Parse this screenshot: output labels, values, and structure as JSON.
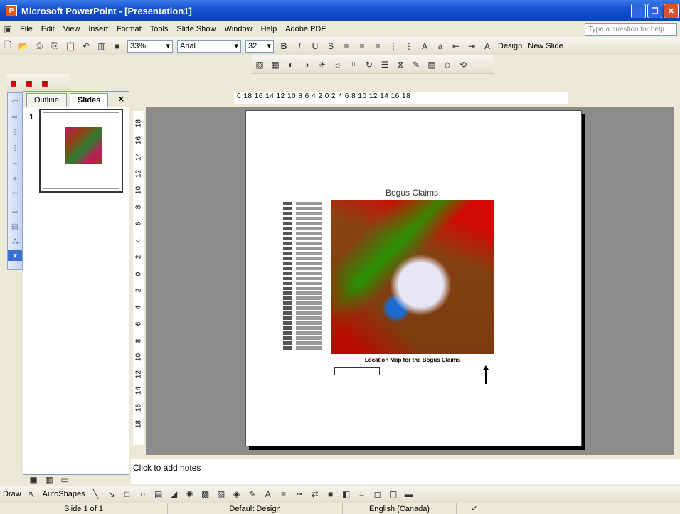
{
  "window": {
    "title": "Microsoft PowerPoint - [Presentation1]",
    "app_icon": "P"
  },
  "menu": {
    "items": [
      "File",
      "Edit",
      "View",
      "Insert",
      "Format",
      "Tools",
      "Slide Show",
      "Window",
      "Help",
      "Adobe PDF"
    ],
    "help_placeholder": "Type a question for help"
  },
  "toolbar": {
    "zoom": "33%",
    "font": "Arial",
    "font_size": "32",
    "design_label": "Design",
    "new_slide_label": "New Slide"
  },
  "panel": {
    "tabs": [
      "Outline",
      "Slides"
    ],
    "active_tab": "Slides",
    "slide_number": "1"
  },
  "ruler": {
    "horizontal": "0  18  16  14  12  10  8  6  4  2  0  2  4  6  8  10  12  14  16  18",
    "vertical": [
      "18",
      "16",
      "14",
      "12",
      "10",
      "8",
      "6",
      "4",
      "2",
      "0",
      "2",
      "4",
      "6",
      "8",
      "10",
      "12",
      "14",
      "16",
      "18"
    ]
  },
  "slide": {
    "title": "Bogus Claims",
    "map_caption": "Location Map for the Bogus Claims"
  },
  "notes": {
    "placeholder": "Click to add notes"
  },
  "drawbar": {
    "draw_label": "Draw",
    "autoshapes_label": "AutoShapes"
  },
  "status": {
    "slide_pos": "Slide 1 of 1",
    "design": "Default Design",
    "language": "English (Canada)"
  }
}
